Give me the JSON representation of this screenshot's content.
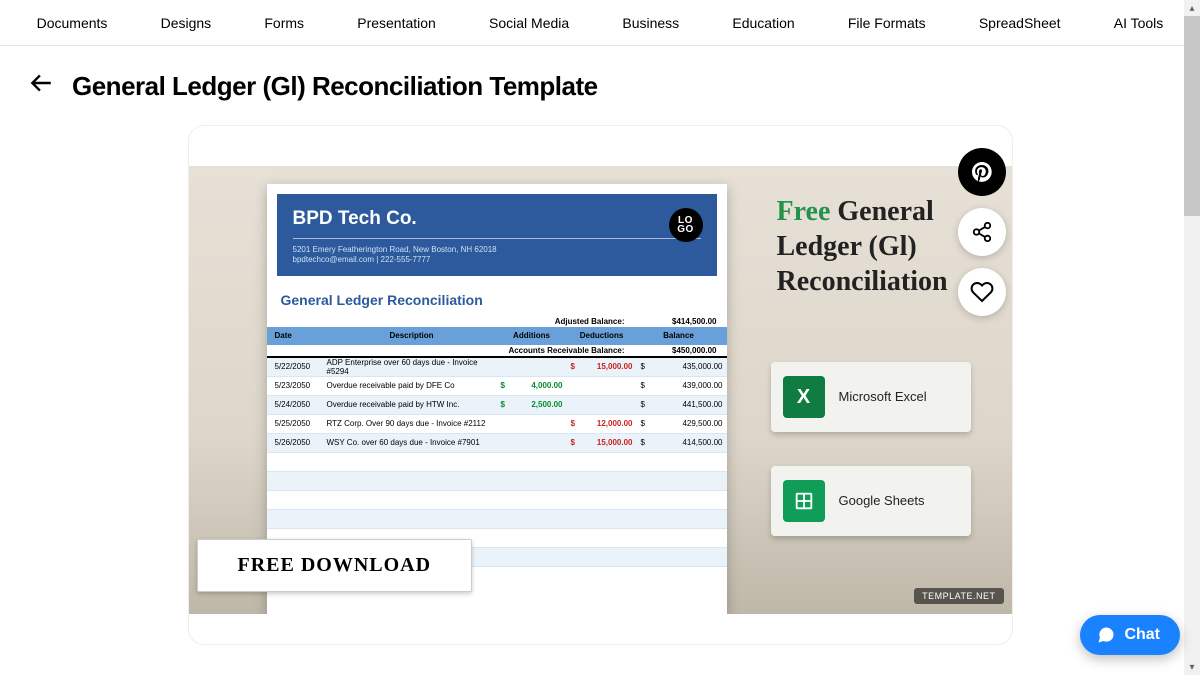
{
  "nav": [
    "Documents",
    "Designs",
    "Forms",
    "Presentation",
    "Social Media",
    "Business",
    "Education",
    "File Formats",
    "SpreadSheet",
    "AI Tools"
  ],
  "page_title": "General Ledger (Gl) Reconciliation Template",
  "doc": {
    "company": "BPD Tech Co.",
    "address1": "5201 Emery Featherington Road, New Boston, NH 62018",
    "address2": "bpdtechco@email.com | 222-555-7777",
    "logo_text": "LO\nGO",
    "title": "General Ledger Reconciliation",
    "adjusted_label": "Adjusted Balance:",
    "adjusted_val": "$414,500.00",
    "ar_label": "Accounts Receivable Balance:",
    "ar_val": "$450,000.00",
    "headers": {
      "date": "Date",
      "desc": "Description",
      "add": "Additions",
      "ded": "Deductions",
      "bal": "Balance"
    },
    "rows": [
      {
        "date": "5/22/2050",
        "desc": "ADP Enterprise over 60 days due - Invoice #5294",
        "add": "",
        "ded": "15,000.00",
        "bal": "435,000.00"
      },
      {
        "date": "5/23/2050",
        "desc": "Overdue receivable paid by DFE Co",
        "add": "4,000.00",
        "ded": "",
        "bal": "439,000.00"
      },
      {
        "date": "5/24/2050",
        "desc": "Overdue receivable paid by HTW Inc.",
        "add": "2,500.00",
        "ded": "",
        "bal": "441,500.00"
      },
      {
        "date": "5/25/2050",
        "desc": "RTZ Corp. Over 90 days due - Invoice #2112",
        "add": "",
        "ded": "12,000.00",
        "bal": "429,500.00"
      },
      {
        "date": "5/26/2050",
        "desc": "WSY Co. over 60 days due - Invoice #7901",
        "add": "",
        "ded": "15,000.00",
        "bal": "414,500.00"
      }
    ]
  },
  "download_label": "FREE DOWNLOAD",
  "watermark": "TEMPLATE.NET",
  "side": {
    "free": "Free",
    "rest": " General Ledger (Gl) Reconciliation",
    "excel": "Microsoft Excel",
    "sheets": "Google Sheets"
  },
  "chat_label": "Chat"
}
